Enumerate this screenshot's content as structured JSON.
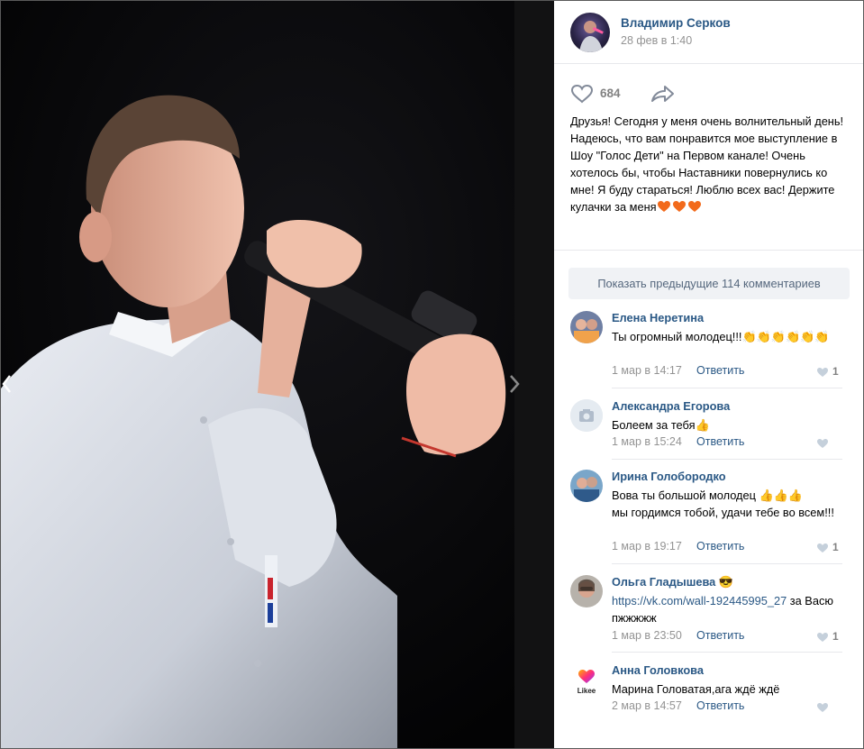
{
  "post": {
    "author": "Владимир Серков",
    "date": "28 фев в 1:40",
    "likes": "684",
    "text": "Друзья! Сегодня у меня очень волнительный день! Надеюсь, что вам понравится мое выступление в Шоу \"Голос Дети\" на Первом канале! Очень хотелось бы, чтобы Наставники повернулись ко мне! Я буду стараться! Люблю всех вас! Держите кулачки за меня",
    "text_hearts": 3,
    "heart_color": "#f26a1b"
  },
  "comments_toggle": "Показать предыдущие 114 комментариев",
  "reply_label": "Ответить",
  "comments": [
    {
      "author": "Елена Неретина",
      "text": "Ты огромный молодец!!!",
      "emoji": "👏👏👏👏👏👏",
      "date": "1 мар в 14:17",
      "likes": "1"
    },
    {
      "author": "Александра Егорова",
      "text": "Болеем за тебя",
      "emoji": "👍",
      "date": "1 мар в 15:24",
      "likes": ""
    },
    {
      "author": "Ирина Голобородко",
      "text": "Вова ты большой молодец",
      "emoji": "👍👍👍",
      "text2": "мы гордимся тобой, удачи тебе во всем!!!",
      "date": "1 мар в 19:17",
      "likes": "1"
    },
    {
      "author": "Ольга Гладышева",
      "author_emoji": "😎",
      "link": "https://vk.com/wall-192445995_27",
      "text": "за Васю пжжжжж",
      "date": "1 мар в 23:50",
      "likes": "1"
    },
    {
      "author": "Анна Головкова",
      "avatar_label": "Likee",
      "text": "Марина Головатая,ага ждё ждё",
      "date": "2 мар в 14:57",
      "likes": ""
    }
  ],
  "colors": {
    "link": "#2a5885",
    "muted": "#939393",
    "divider": "#e7e8ec"
  }
}
